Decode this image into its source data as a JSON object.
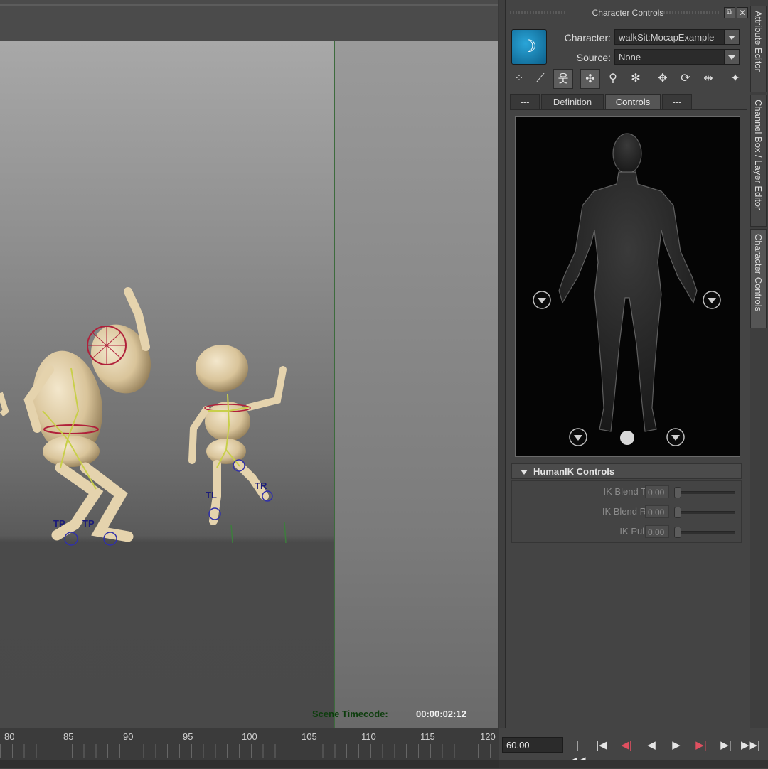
{
  "viewport": {
    "timecode_label": "Scene Timecode:",
    "timecode_value": "00:00:02:12",
    "markers": [
      "TP",
      "TP",
      "TL",
      "TR"
    ]
  },
  "panel": {
    "title": "Character Controls",
    "float_icon": "float-icon",
    "close_label": "✕",
    "logo_glyph": "☽",
    "character_label": "Character:",
    "character_value": "walkSit:MocapExample",
    "source_label": "Source:",
    "source_value": "None",
    "toolbar": [
      {
        "name": "full-body-icon",
        "glyph": "⁘"
      },
      {
        "name": "bone-icon",
        "glyph": "⟋"
      },
      {
        "name": "stick-figure-icon",
        "glyph": "웃",
        "active": true
      },
      {
        "name": "effector-figure-icon",
        "glyph": "✣",
        "active": true
      },
      {
        "name": "pin-figure-icon",
        "glyph": "⚲"
      },
      {
        "name": "grey-figure-icon",
        "glyph": "✻"
      },
      {
        "name": "translate-figure-icon",
        "glyph": "✥"
      },
      {
        "name": "rotate-figure-icon",
        "glyph": "⟳"
      },
      {
        "name": "pin-arrows-icon",
        "glyph": "⇹"
      },
      {
        "name": "reach-figure-icon",
        "glyph": "✦"
      }
    ],
    "tabs": [
      "---",
      "Definition",
      "Controls",
      "---"
    ],
    "selected_tab": "Controls",
    "section_title": "HumanIK Controls",
    "sliders": [
      {
        "label": "IK Blend T",
        "value": "0.00"
      },
      {
        "label": "IK Blend R",
        "value": "0.00"
      },
      {
        "label": "IK Pull",
        "value": "0.00"
      }
    ]
  },
  "side_tabs": [
    "Attribute Editor",
    "Channel Box / Layer Editor",
    "Character Controls"
  ],
  "timeline": {
    "ticks": [
      "80",
      "85",
      "90",
      "95",
      "100",
      "105",
      "110",
      "115",
      "120"
    ],
    "current_frame": "60.00"
  },
  "playback": [
    {
      "name": "go-to-start-button",
      "glyph": "|◀◀"
    },
    {
      "name": "step-back-key-button",
      "glyph": "|◀"
    },
    {
      "name": "step-back-frame-button",
      "glyph": "◀|"
    },
    {
      "name": "play-backward-button",
      "glyph": "◀"
    },
    {
      "name": "play-forward-button",
      "glyph": "▶"
    },
    {
      "name": "step-forward-frame-button",
      "glyph": "▶|"
    },
    {
      "name": "step-forward-key-button",
      "glyph": "▶|"
    },
    {
      "name": "go-to-end-button",
      "glyph": "▶▶|"
    }
  ],
  "colors": {
    "accent": "#1f8fc7",
    "timecode_label": "#0d3d0d",
    "viewport_divider": "#3d6b3d",
    "marker_text": "#1b1b7a",
    "ik_red": "#b0203a"
  }
}
